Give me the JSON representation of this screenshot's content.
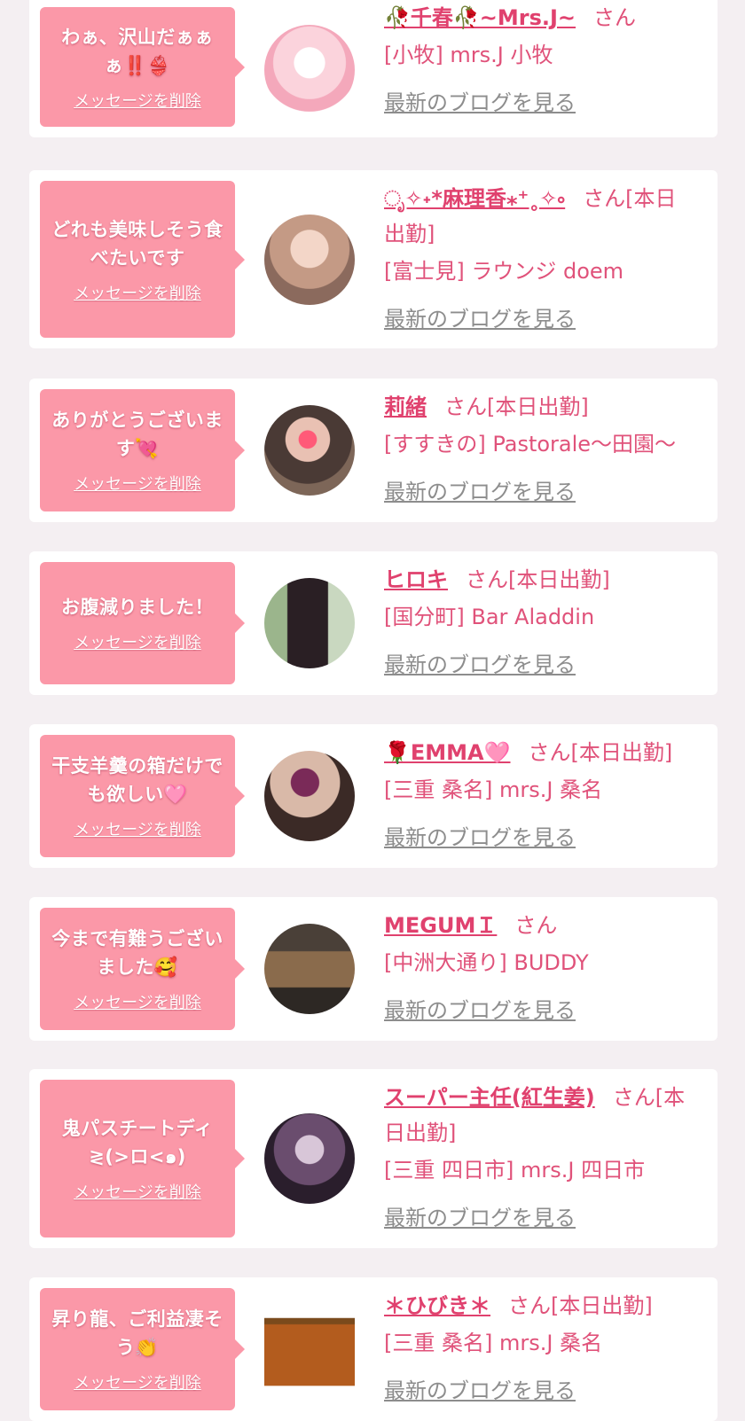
{
  "accent_color": "#e0416e",
  "bubble_color": "#fb98a8",
  "messages": [
    {
      "text": "わぁ、沢山だぁぁぁ‼️👙",
      "delete_label": "メッセージを削除",
      "sender_name": "🥀千春🥀~Mrs.J~",
      "suffix": "さん",
      "shop": "[小牧] mrs.J 小牧",
      "blog_link": "最新のブログを見る",
      "avatar_icon": "pink-rabbit-plush-avatar"
    },
    {
      "text": "どれも美味しそう食べたいです",
      "delete_label": "メッセージを削除",
      "sender_name": "ೃ✧˖*麻理香⁎⁺˳✧༚",
      "suffix": "さん[本日出勤]",
      "shop": "[富士見] ラウンジ doem",
      "blog_link": "最新のブログを見る",
      "avatar_icon": "woman-portrait-avatar"
    },
    {
      "text": "ありがとうございます💘",
      "delete_label": "メッセージを削除",
      "sender_name": "莉緒",
      "suffix": "さん[本日出勤]",
      "shop": "[すすきの] Pastorale〜田園〜",
      "blog_link": "最新のブログを見る",
      "avatar_icon": "woman-with-heart-sticker-avatar"
    },
    {
      "text": "お腹減りました！",
      "delete_label": "メッセージを削除",
      "sender_name": "ヒロキ",
      "suffix": "さん[本日出勤]",
      "shop": "[国分町] Bar Aladdin",
      "blog_link": "最新のブログを見る",
      "avatar_icon": "woman-full-body-avatar"
    },
    {
      "text": "干支羊羹の箱だけでも欲しい🩷",
      "delete_label": "メッセージを削除",
      "sender_name": "🌹EMMA🩷",
      "suffix": "さん[本日出勤]",
      "shop": "[三重 桑名] mrs.J 桑名",
      "blog_link": "最新のブログを見る",
      "avatar_icon": "kimono-woman-avatar"
    },
    {
      "text": "今まで有難うございました🥰",
      "delete_label": "メッセージを削除",
      "sender_name": "MEGUMＩ",
      "suffix": "さん",
      "shop": "[中洲大通り] BUDDY",
      "blog_link": "最新のブログを見る",
      "avatar_icon": "kimono-standing-avatar"
    },
    {
      "text": "鬼パスチートディ≷(>ロ<๑)",
      "delete_label": "メッセージを削除",
      "sender_name": "スーパー主任(紅生姜)",
      "suffix": "さん[本日出勤]",
      "shop": "[三重 四日市] mrs.J 四日市",
      "blog_link": "最新のブログを見る",
      "avatar_icon": "anime-character-avatar"
    },
    {
      "text": "昇り龍、ご利益凄そう👏",
      "delete_label": "メッセージを削除",
      "sender_name": "＊ひびき＊",
      "suffix": "さん[本日出勤]",
      "shop": "[三重 桑名] mrs.J 桑名",
      "blog_link": "最新のブログを見る",
      "avatar_icon": "whisky-bottle-avatar"
    }
  ]
}
